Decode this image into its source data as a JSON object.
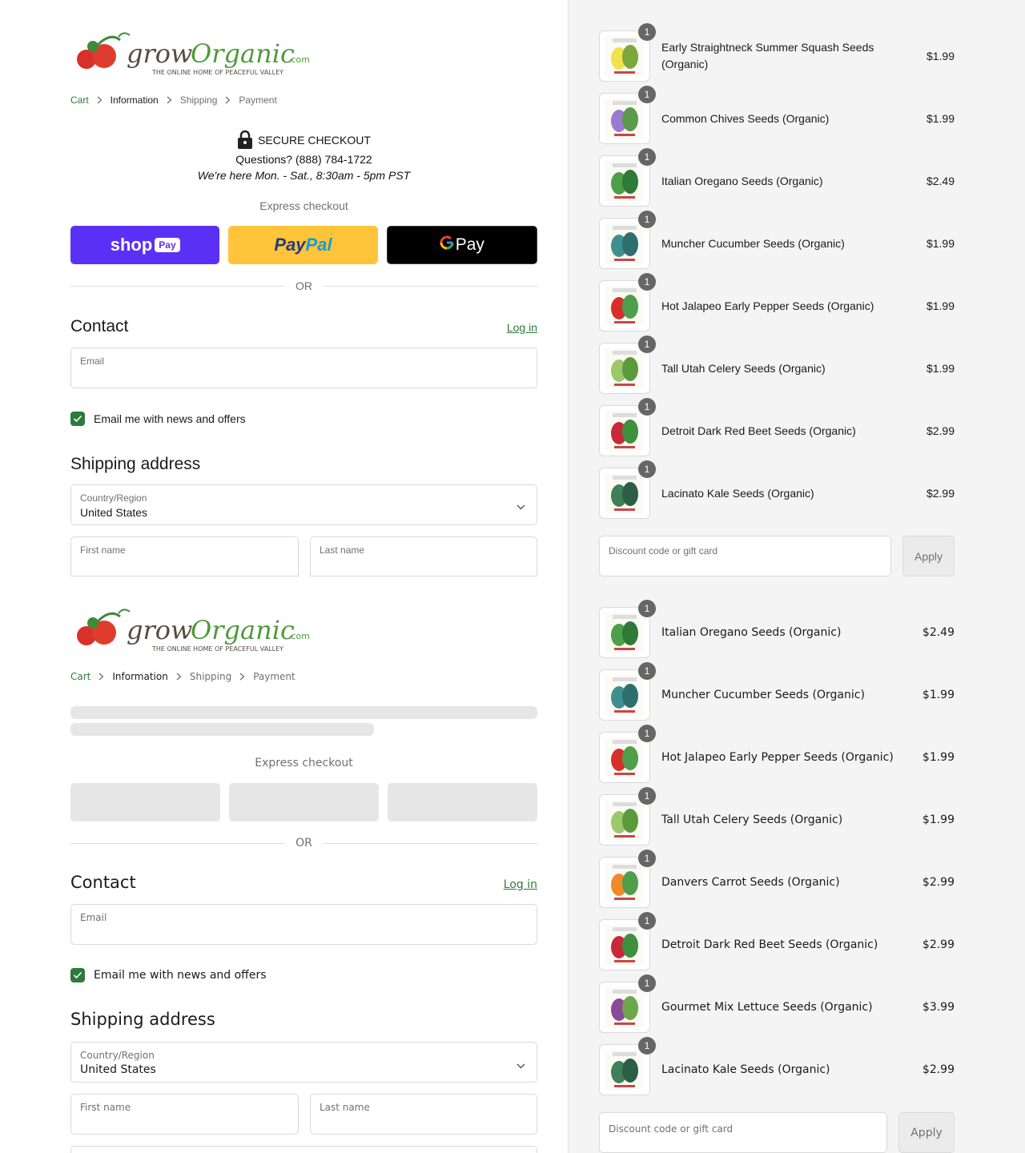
{
  "brand": {
    "name_part1": "grow",
    "name_part2": "Organic",
    "name_suffix": ".com",
    "tagline": "THE ONLINE HOME OF PEACEFUL VALLEY"
  },
  "breadcrumb": {
    "cart": "Cart",
    "information": "Information",
    "shipping": "Shipping",
    "payment": "Payment"
  },
  "secure": {
    "title": "SECURE CHECKOUT",
    "questions": "Questions? (888) 784-1722",
    "hours": "We're here Mon. - Sat., 8:30am - 5pm PST"
  },
  "express": {
    "label": "Express checkout",
    "shop_label": "shop",
    "shop_badge": "Pay",
    "paypal_a": "Pay",
    "paypal_b": "Pal",
    "gpay_g": "G",
    "gpay_label": "Pay"
  },
  "or_text": "OR",
  "contact": {
    "heading": "Contact",
    "login": "Log in",
    "email_label": "Email",
    "news_label": "Email me with news and offers"
  },
  "shipping": {
    "heading": "Shipping address",
    "country_label": "Country/Region",
    "country_value": "United States",
    "first_name": "First name",
    "last_name": "Last name"
  },
  "order_a": {
    "items": [
      {
        "name": "Early Straightneck Summer Squash Seeds (Organic)",
        "price": "$1.99",
        "qty": "1",
        "icon": "squash-seed-packet"
      },
      {
        "name": "Common Chives Seeds (Organic)",
        "price": "$1.99",
        "qty": "1",
        "icon": "chives-seed-packet"
      },
      {
        "name": "Italian Oregano Seeds (Organic)",
        "price": "$2.49",
        "qty": "1",
        "icon": "oregano-seed-packet"
      },
      {
        "name": "Muncher Cucumber Seeds (Organic)",
        "price": "$1.99",
        "qty": "1",
        "icon": "cucumber-seed-packet"
      },
      {
        "name": "Hot Jalapeo Early Pepper Seeds (Organic)",
        "price": "$1.99",
        "qty": "1",
        "icon": "pepper-seed-packet"
      },
      {
        "name": "Tall Utah Celery Seeds (Organic)",
        "price": "$1.99",
        "qty": "1",
        "icon": "celery-seed-packet"
      },
      {
        "name": "Detroit Dark Red Beet Seeds (Organic)",
        "price": "$2.99",
        "qty": "1",
        "icon": "beet-seed-packet"
      },
      {
        "name": "Lacinato Kale Seeds (Organic)",
        "price": "$2.99",
        "qty": "1",
        "icon": "kale-seed-packet"
      }
    ],
    "discount_label": "Discount code or gift card",
    "apply_label": "Apply"
  },
  "order_b": {
    "items": [
      {
        "name": "Italian Oregano Seeds (Organic)",
        "price": "$2.49",
        "qty": "1",
        "icon": "oregano-seed-packet"
      },
      {
        "name": "Muncher Cucumber Seeds (Organic)",
        "price": "$1.99",
        "qty": "1",
        "icon": "cucumber-seed-packet"
      },
      {
        "name": "Hot Jalapeo Early Pepper Seeds (Organic)",
        "price": "$1.99",
        "qty": "1",
        "icon": "pepper-seed-packet"
      },
      {
        "name": "Tall Utah Celery Seeds (Organic)",
        "price": "$1.99",
        "qty": "1",
        "icon": "celery-seed-packet"
      },
      {
        "name": "Danvers Carrot Seeds (Organic)",
        "price": "$2.99",
        "qty": "1",
        "icon": "carrot-seed-packet"
      },
      {
        "name": "Detroit Dark Red Beet Seeds (Organic)",
        "price": "$2.99",
        "qty": "1",
        "icon": "beet-seed-packet"
      },
      {
        "name": "Gourmet Mix Lettuce Seeds (Organic)",
        "price": "$3.99",
        "qty": "1",
        "icon": "lettuce-seed-packet"
      },
      {
        "name": "Lacinato Kale Seeds (Organic)",
        "price": "$2.99",
        "qty": "1",
        "icon": "kale-seed-packet"
      }
    ],
    "discount_label": "Discount code or gift card",
    "apply_label": "Apply"
  },
  "colors": {
    "accent_green": "#2d7a3a",
    "shop_pay": "#5a31f4",
    "paypal_yellow": "#ffc439"
  }
}
